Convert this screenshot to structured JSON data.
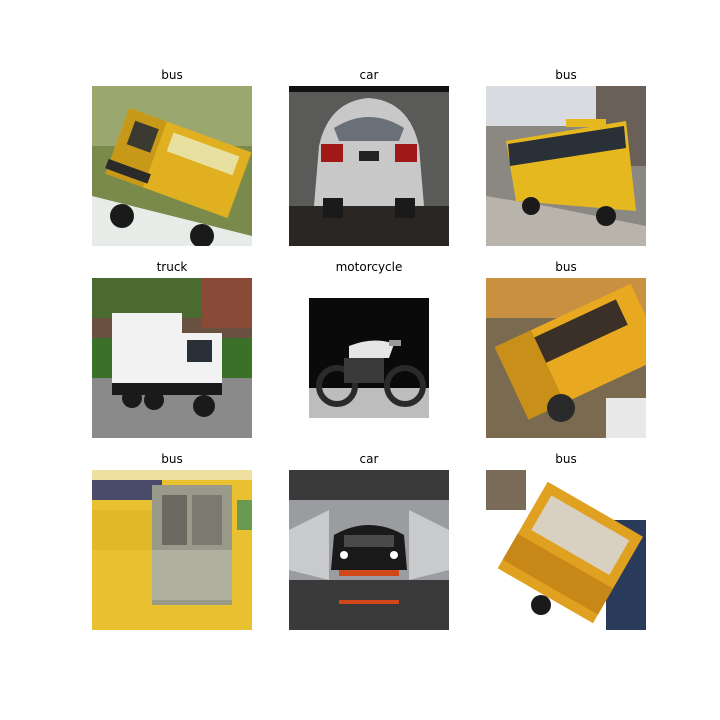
{
  "grid": {
    "tiles": [
      {
        "label": "bus",
        "image": "yellow-school-bus-tilted-blurry"
      },
      {
        "label": "car",
        "image": "silver-sedan-rear-view"
      },
      {
        "label": "bus",
        "image": "yellow-school-bus-street"
      },
      {
        "label": "truck",
        "image": "white-garbage-truck"
      },
      {
        "label": "motorcycle",
        "image": "black-cafe-racer-motorcycle"
      },
      {
        "label": "bus",
        "image": "yellow-school-bus-rotated-noisy"
      },
      {
        "label": "bus",
        "image": "yellow-bus-door-closeup"
      },
      {
        "label": "car",
        "image": "black-sports-car-spray"
      },
      {
        "label": "bus",
        "image": "yellow-school-bus-rotated"
      }
    ]
  },
  "colors": {
    "bus_yellow": "#e8b820",
    "background": "#ffffff"
  }
}
